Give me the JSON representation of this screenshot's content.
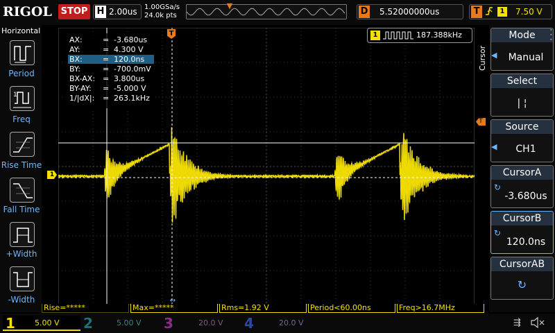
{
  "brand": "RIGOL",
  "run_state": "STOP",
  "horizontal": {
    "label": "H",
    "timebase": "2.00us",
    "sample_rate": "1.00GSa/s",
    "memory_points": "24.0k pts"
  },
  "delay": {
    "label": "D",
    "value": "5.52000000us"
  },
  "trigger": {
    "label": "T",
    "source": "1",
    "level": "7.50 V"
  },
  "left_menu": {
    "title": "Horizontal",
    "items": [
      {
        "label": "Period"
      },
      {
        "label": "Freq"
      },
      {
        "label": "Rise Time"
      },
      {
        "label": "Fall Time"
      },
      {
        "label": "+Width"
      },
      {
        "label": "-Width"
      }
    ]
  },
  "cursor_readout": [
    {
      "name": "AX:",
      "eq": "=",
      "value": "-3.680us"
    },
    {
      "name": "AY:",
      "eq": "=",
      "value": "4.300 V"
    },
    {
      "name": "BX:",
      "eq": "=",
      "value": "120.0ns"
    },
    {
      "name": "BY:",
      "eq": "=",
      "value": "-700.0mV"
    },
    {
      "name": "BX-AX:",
      "eq": "=",
      "value": "3.800us"
    },
    {
      "name": "BY-AY:",
      "eq": "=",
      "value": "-5.000 V"
    },
    {
      "name": "1/|dX|:",
      "eq": "=",
      "value": "263.1kHz"
    }
  ],
  "freq_counter": {
    "channel": "1",
    "value": "187.388kHz"
  },
  "trace_marker": {
    "channel": "1"
  },
  "right_menu": {
    "title": "Cursor",
    "mode": {
      "label": "Mode",
      "value": "Manual"
    },
    "select": {
      "label": "Select",
      "value": "|   ¦"
    },
    "source": {
      "label": "Source",
      "value": "CH1"
    },
    "cursor_a": {
      "label": "CursorA",
      "value": "-3.680us"
    },
    "cursor_b": {
      "label": "CursorB",
      "value": "120.0ns"
    },
    "cursor_ab": {
      "label": "CursorAB"
    }
  },
  "measurements": [
    {
      "label": "Rise=*****"
    },
    {
      "label": "Max=*****"
    },
    {
      "label": "Rms=1.92 V"
    },
    {
      "label": "Period<60.00ns"
    },
    {
      "label": "Freq>16.7MHz"
    }
  ],
  "channels": [
    {
      "num": "1",
      "scale": "5.00 V",
      "color": "#f5e100",
      "active": true
    },
    {
      "num": "2",
      "scale": "5.00 V",
      "color": "#1f6f73",
      "active": false
    },
    {
      "num": "3",
      "scale": "20.0 V",
      "color": "#8a2a8a",
      "active": false
    },
    {
      "num": "4",
      "scale": "20.0 V",
      "color": "#2a4a9a",
      "active": false
    }
  ],
  "colors": {
    "ch1": "#f5e100",
    "trigger": "#e87a1b",
    "accent": "#6ab6ff",
    "stop": "#c21d1d"
  }
}
